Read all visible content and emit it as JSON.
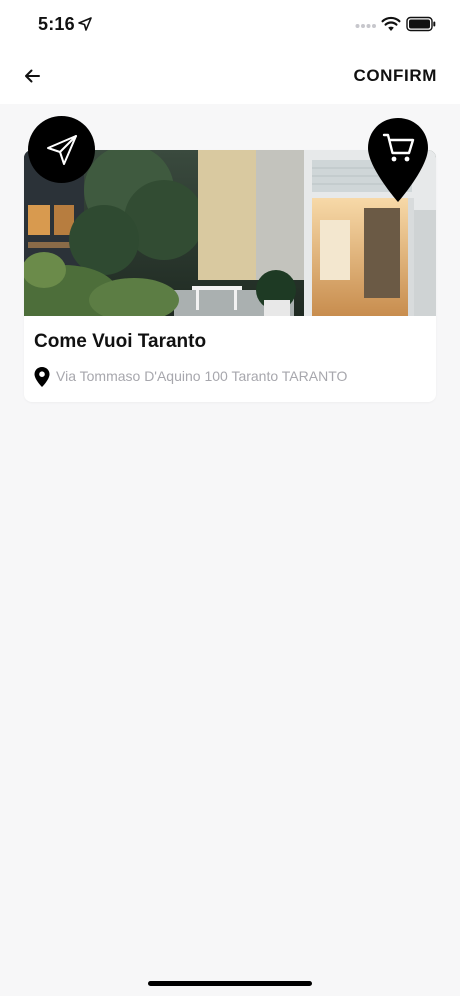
{
  "status_bar": {
    "time": "5:16"
  },
  "header": {
    "confirm_label": "CONFIRM"
  },
  "store": {
    "name": "Come Vuoi Taranto",
    "address": "Via Tommaso D'Aquino 100 Taranto TARANTO"
  },
  "colors": {
    "accent": "#000000",
    "address_text": "#a7a7ad",
    "background": "#f7f7f8"
  }
}
